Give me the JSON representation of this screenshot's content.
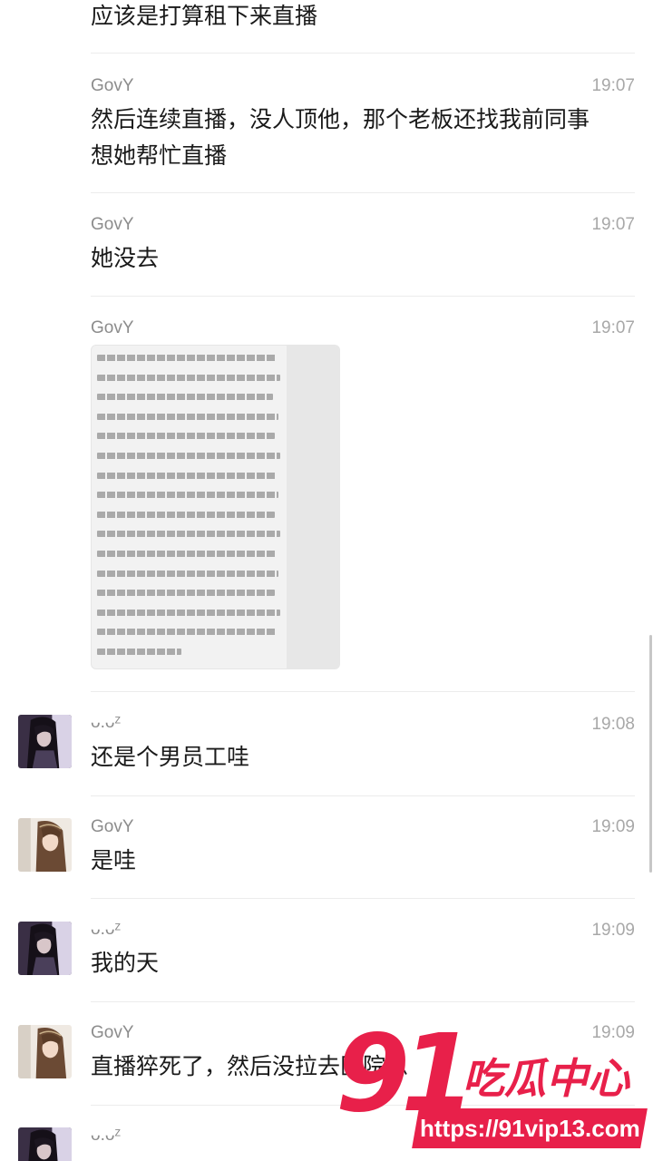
{
  "messages": [
    {
      "sender": "",
      "time": "",
      "text": "应该是打算租下来直播",
      "avatar": "none"
    },
    {
      "sender": "GovY",
      "time": "19:07",
      "text_lines": [
        "然后连续直播，没人顶他，那个老板还找我前同事",
        "想她帮忙直播"
      ],
      "avatar": "none"
    },
    {
      "sender": "GovY",
      "time": "19:07",
      "text": "她没去",
      "avatar": "none"
    },
    {
      "sender": "GovY",
      "time": "19:07",
      "type": "image",
      "avatar": "none"
    },
    {
      "sender": "ᴗ.ᴗᶻ",
      "time": "19:08",
      "text": "还是个男员工哇",
      "avatar": "dark-haired-girl-avatar"
    },
    {
      "sender": "GovY",
      "time": "19:09",
      "text": "是哇",
      "avatar": "brown-haired-girl-avatar"
    },
    {
      "sender": "ᴗ.ᴗᶻ",
      "time": "19:09",
      "text": "我的天",
      "avatar": "dark-haired-girl-avatar"
    },
    {
      "sender": "GovY",
      "time": "19:09",
      "text": "直播猝死了，然后没拉去医院急",
      "avatar": "brown-haired-girl-avatar"
    },
    {
      "sender": "ᴗ.ᴗᶻ",
      "time": "",
      "text": "",
      "avatar": "dark-haired-girl-avatar"
    }
  ],
  "watermark": {
    "number": "91",
    "name": "吃瓜中心",
    "url": "https://91vip13.com"
  },
  "colors": {
    "background": "#ffffff",
    "sender": "#8c8c8c",
    "time": "#a8a8a8",
    "message_text": "#1a1a1a",
    "separator": "#ececec",
    "watermark": "#e8204a"
  }
}
